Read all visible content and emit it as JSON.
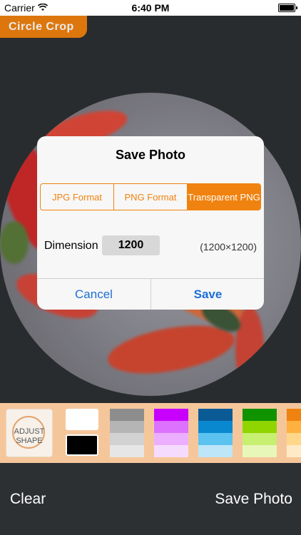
{
  "status": {
    "carrier": "Carrier",
    "time": "6:40 PM"
  },
  "app": {
    "title": "Circle Crop"
  },
  "dialog": {
    "title": "Save Photo",
    "formats": [
      "JPG Format",
      "PNG Format",
      "Transparent PNG"
    ],
    "selected_format": "Transparent PNG",
    "dimension_label": "Dimension",
    "dimension_value": "1200",
    "dimension_preview": "(1200×1200)",
    "cancel_label": "Cancel",
    "save_label": "Save"
  },
  "palette": {
    "adjust_label_line1": "ADJUST",
    "adjust_label_line2": "SHAPE",
    "colors": {
      "white": "#ffffff",
      "black": "#000000",
      "gray": [
        "#8d8d8d",
        "#b5b5b5",
        "#d2d2d2",
        "#e6e6e6"
      ],
      "purple": [
        "#c700ff",
        "#dd72ff",
        "#ecafff",
        "#f5dcff"
      ],
      "blue": [
        "#0a5a96",
        "#0a88cf",
        "#5cc2f0",
        "#bde6f8"
      ],
      "green": [
        "#109300",
        "#90d400",
        "#c7ef70",
        "#e7f7b8"
      ],
      "orange": [
        "#f0820f",
        "#ffb140",
        "#ffd68a",
        "#ffeac6"
      ]
    }
  },
  "toolbar": {
    "clear_label": "Clear",
    "save_photo_label": "Save Photo"
  }
}
